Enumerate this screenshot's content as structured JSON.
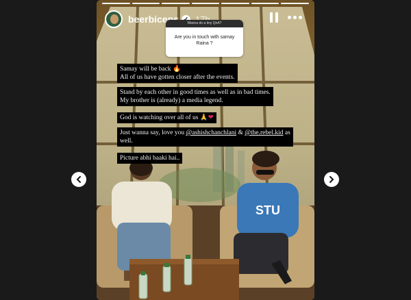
{
  "story": {
    "username": "beerbiceps",
    "time": "17h",
    "progress_segments": 7,
    "progress_done": 7
  },
  "question": {
    "header": "Wanna do a tiny QnA?",
    "text": "Are you in touch with samay Raina ?"
  },
  "captions": {
    "line1a": "Samay will be back",
    "line1b": "All of us have gotten closer after the events.",
    "line2a": "Stand by each other in good times as well as in bad times.",
    "line2b": "My brother is (already) a media legend.",
    "line3": "God is watching over all of us",
    "line4a": "Just wanna say, love you",
    "mention1": "@ashishchanchlani",
    "amp": "&",
    "mention2": "@the.rebel.kid",
    "line4b": "as",
    "line4c": "well.",
    "line5": "Picture abhi baaki hai.."
  },
  "shirt_text": "STU",
  "icons": {
    "pause": "pause-icon",
    "more": "more-options-icon",
    "verified": "verified-badge-icon",
    "prev": "chevron-left-icon",
    "next": "chevron-right-icon"
  }
}
